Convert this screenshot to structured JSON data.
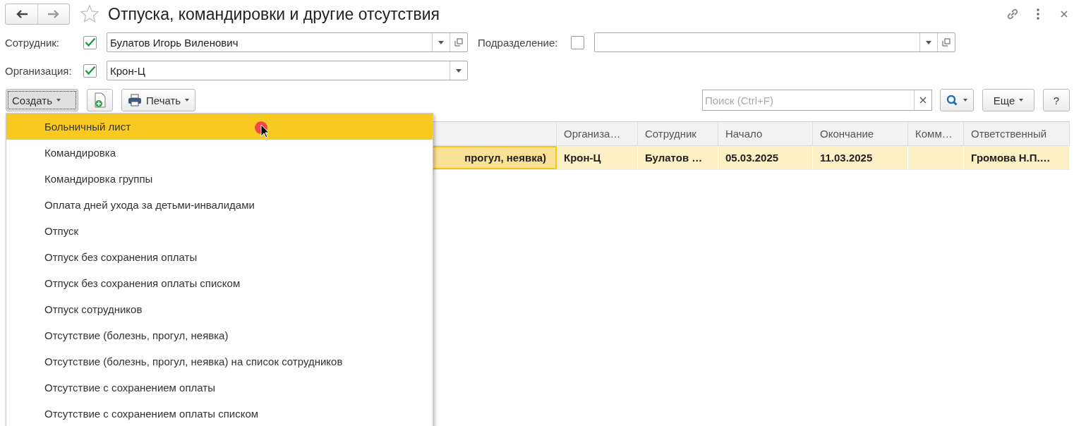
{
  "window": {
    "title": "Отпуска, командировки и другие отсутствия"
  },
  "filters": [
    {
      "label": "Сотрудник:",
      "checked": true,
      "value": "Булатов Игорь Виленович",
      "open_button": true
    },
    {
      "label": "Подразделение:",
      "checked": false,
      "open_button": true
    },
    {
      "label": "Организация:",
      "checked": true,
      "value": "Крон-Ц",
      "open_button": false
    }
  ],
  "toolbar": {
    "create": "Создать",
    "print": "Печать",
    "search": {
      "placeholder": "Поиск (Ctrl+F)"
    },
    "more": "Еще",
    "help": "?"
  },
  "table": {
    "columns": [
      "",
      "Организа…",
      "Сотрудник",
      "Начало",
      "Окончание",
      "Комм…",
      "Ответственный"
    ],
    "rows": [
      {
        "selected": true,
        "cells": [
          "прогул, неявка)",
          "Крон-Ц",
          "Булатов …",
          "05.03.2025",
          "11.03.2025",
          "",
          "Громова Н.П.…"
        ]
      }
    ]
  },
  "create_menu": {
    "items": [
      {
        "label": "Больничный лист",
        "selected": true
      },
      {
        "label": "Командировка",
        "selected": false
      },
      {
        "label": "Командировка группы",
        "selected": false
      },
      {
        "label": "Оплата дней ухода за детьми-инвалидами",
        "selected": false
      },
      {
        "label": "Отпуск",
        "selected": false
      },
      {
        "label": "Отпуск без сохранения оплаты",
        "selected": false
      },
      {
        "label": "Отпуск без сохранения оплаты списком",
        "selected": false
      },
      {
        "label": "Отпуск сотрудников",
        "selected": false
      },
      {
        "label": "Отсутствие (болезнь, прогул, неявка)",
        "selected": false
      },
      {
        "label": "Отсутствие (болезнь, прогул, неявка) на список сотрудников",
        "selected": false
      },
      {
        "label": "Отсутствие с сохранением оплаты",
        "selected": false
      },
      {
        "label": "Отсутствие с сохранением оплаты списком",
        "selected": false
      }
    ]
  }
}
